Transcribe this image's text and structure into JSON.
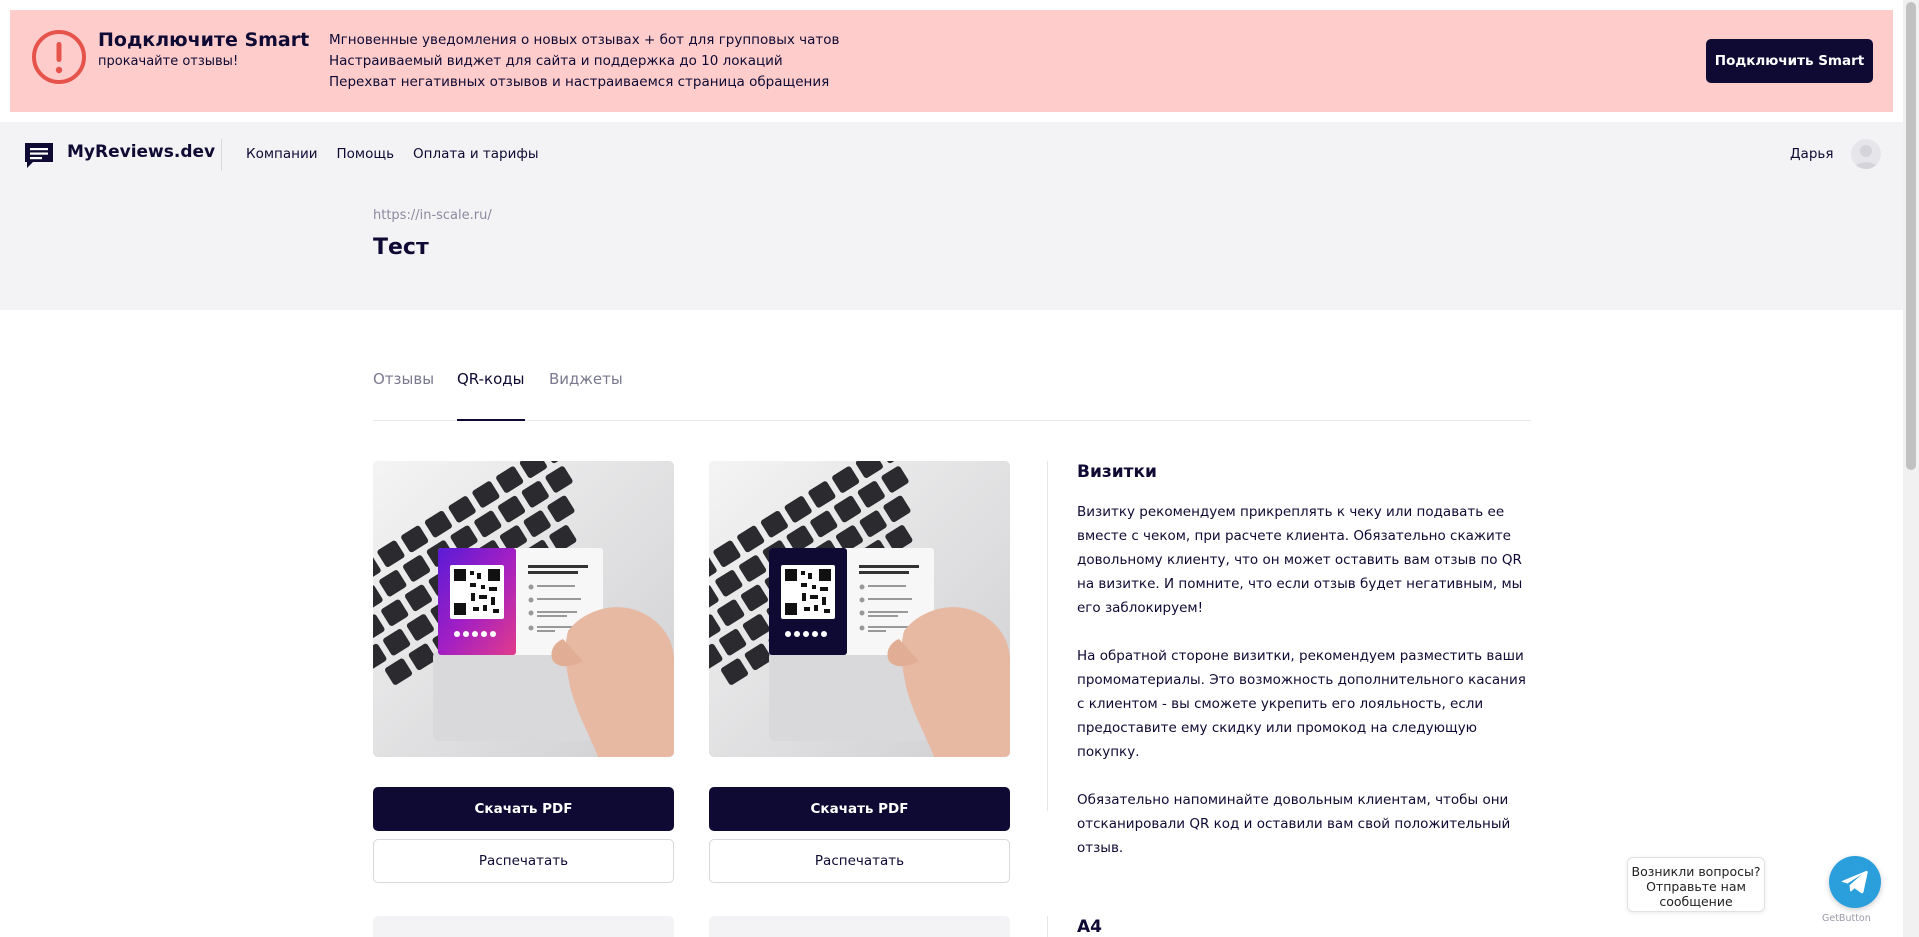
{
  "promo": {
    "title": "Подключите Smart",
    "subtitle": "прокачайте отзывы!",
    "features": [
      "Мгновенные уведомления о новых отзывах + бот для групповых чатов",
      "Настраиваемый виджет для сайта и поддержка до 10 локаций",
      "Перехват негативных отзывов и настраиваемся страница обращения"
    ],
    "button_label": "Подключить Smart",
    "alert_icon": "exclamation-circle-icon",
    "bg_color": "#ffcccc",
    "alert_color": "#e5534b"
  },
  "header": {
    "logo_text": "MyReviews.dev",
    "logo_icon": "chat-bubble-icon",
    "nav": [
      "Компании",
      "Помощь",
      "Оплата и тарифы"
    ],
    "user_name": "Дарья"
  },
  "company": {
    "url": "https://in-scale.ru/",
    "title": "Тест"
  },
  "tabs": {
    "items": [
      "Отзывы",
      "QR-коды",
      "Виджеты"
    ],
    "active": "QR-коды"
  },
  "cards": [
    {
      "variant": "gradient",
      "download_label": "Скачать PDF",
      "print_label": "Распечатать",
      "card_heading": "Оставьте свой отзыв об этом месте",
      "card_steps": [
        "Наведи камеру на QR",
        "Оцените обслуживание",
        "Выберите, где хотите оставить отзыв",
        "Напишите подробный отзыв"
      ]
    },
    {
      "variant": "dark",
      "download_label": "Скачать PDF",
      "print_label": "Распечатать",
      "card_heading": "Оставьте свой отзыв об этом месте",
      "card_steps": [
        "Наведи камеру на QR",
        "Оцените обслуживание",
        "Выберите, где хотите оставить отзыв",
        "Напишите подробный отзыв"
      ]
    }
  ],
  "business_cards": {
    "title": "Визитки",
    "paragraphs": [
      "Визитку рекомендуем прикреплять к чеку или подавать ее вместе с чеком, при расчете клиента. Обязательно скажите довольному клиенту, что он может оставить вам отзыв по QR на визитке. И помните, что если отзыв будет негативным, мы его заблокируем!",
      "На обратной стороне визитки, рекомендуем разместить ваши промоматериалы. Это возможность дополнительного касания с клиентом - вы сможете укрепить его лояльность, если предоставите ему скидку или промокод на следующую покупку.",
      "Обязательно напоминайте довольным клиентам, чтобы они отсканировали QR код и оставили вам свой положительный отзыв."
    ]
  },
  "a4": {
    "title": "A4"
  },
  "chat": {
    "bubble_text": "Возникли вопросы? Отправьте нам сообщение",
    "button_icon": "telegram-icon",
    "footer": "GetButton"
  }
}
